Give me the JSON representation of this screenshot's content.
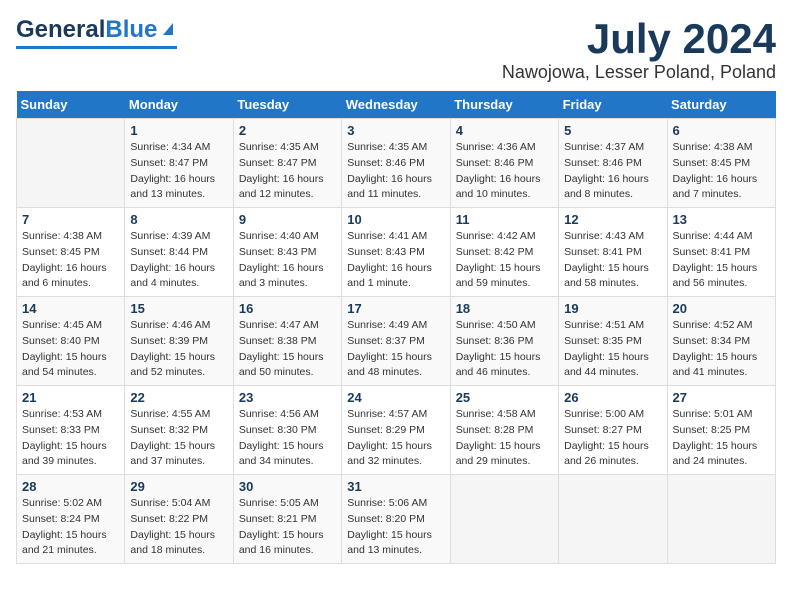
{
  "header": {
    "logo_general": "General",
    "logo_blue": "Blue",
    "main_title": "July 2024",
    "subtitle": "Nawojowa, Lesser Poland, Poland"
  },
  "calendar": {
    "days_of_week": [
      "Sunday",
      "Monday",
      "Tuesday",
      "Wednesday",
      "Thursday",
      "Friday",
      "Saturday"
    ],
    "weeks": [
      [
        {
          "day": "",
          "info": ""
        },
        {
          "day": "1",
          "info": "Sunrise: 4:34 AM\nSunset: 8:47 PM\nDaylight: 16 hours\nand 13 minutes."
        },
        {
          "day": "2",
          "info": "Sunrise: 4:35 AM\nSunset: 8:47 PM\nDaylight: 16 hours\nand 12 minutes."
        },
        {
          "day": "3",
          "info": "Sunrise: 4:35 AM\nSunset: 8:46 PM\nDaylight: 16 hours\nand 11 minutes."
        },
        {
          "day": "4",
          "info": "Sunrise: 4:36 AM\nSunset: 8:46 PM\nDaylight: 16 hours\nand 10 minutes."
        },
        {
          "day": "5",
          "info": "Sunrise: 4:37 AM\nSunset: 8:46 PM\nDaylight: 16 hours\nand 8 minutes."
        },
        {
          "day": "6",
          "info": "Sunrise: 4:38 AM\nSunset: 8:45 PM\nDaylight: 16 hours\nand 7 minutes."
        }
      ],
      [
        {
          "day": "7",
          "info": "Sunrise: 4:38 AM\nSunset: 8:45 PM\nDaylight: 16 hours\nand 6 minutes."
        },
        {
          "day": "8",
          "info": "Sunrise: 4:39 AM\nSunset: 8:44 PM\nDaylight: 16 hours\nand 4 minutes."
        },
        {
          "day": "9",
          "info": "Sunrise: 4:40 AM\nSunset: 8:43 PM\nDaylight: 16 hours\nand 3 minutes."
        },
        {
          "day": "10",
          "info": "Sunrise: 4:41 AM\nSunset: 8:43 PM\nDaylight: 16 hours\nand 1 minute."
        },
        {
          "day": "11",
          "info": "Sunrise: 4:42 AM\nSunset: 8:42 PM\nDaylight: 15 hours\nand 59 minutes."
        },
        {
          "day": "12",
          "info": "Sunrise: 4:43 AM\nSunset: 8:41 PM\nDaylight: 15 hours\nand 58 minutes."
        },
        {
          "day": "13",
          "info": "Sunrise: 4:44 AM\nSunset: 8:41 PM\nDaylight: 15 hours\nand 56 minutes."
        }
      ],
      [
        {
          "day": "14",
          "info": "Sunrise: 4:45 AM\nSunset: 8:40 PM\nDaylight: 15 hours\nand 54 minutes."
        },
        {
          "day": "15",
          "info": "Sunrise: 4:46 AM\nSunset: 8:39 PM\nDaylight: 15 hours\nand 52 minutes."
        },
        {
          "day": "16",
          "info": "Sunrise: 4:47 AM\nSunset: 8:38 PM\nDaylight: 15 hours\nand 50 minutes."
        },
        {
          "day": "17",
          "info": "Sunrise: 4:49 AM\nSunset: 8:37 PM\nDaylight: 15 hours\nand 48 minutes."
        },
        {
          "day": "18",
          "info": "Sunrise: 4:50 AM\nSunset: 8:36 PM\nDaylight: 15 hours\nand 46 minutes."
        },
        {
          "day": "19",
          "info": "Sunrise: 4:51 AM\nSunset: 8:35 PM\nDaylight: 15 hours\nand 44 minutes."
        },
        {
          "day": "20",
          "info": "Sunrise: 4:52 AM\nSunset: 8:34 PM\nDaylight: 15 hours\nand 41 minutes."
        }
      ],
      [
        {
          "day": "21",
          "info": "Sunrise: 4:53 AM\nSunset: 8:33 PM\nDaylight: 15 hours\nand 39 minutes."
        },
        {
          "day": "22",
          "info": "Sunrise: 4:55 AM\nSunset: 8:32 PM\nDaylight: 15 hours\nand 37 minutes."
        },
        {
          "day": "23",
          "info": "Sunrise: 4:56 AM\nSunset: 8:30 PM\nDaylight: 15 hours\nand 34 minutes."
        },
        {
          "day": "24",
          "info": "Sunrise: 4:57 AM\nSunset: 8:29 PM\nDaylight: 15 hours\nand 32 minutes."
        },
        {
          "day": "25",
          "info": "Sunrise: 4:58 AM\nSunset: 8:28 PM\nDaylight: 15 hours\nand 29 minutes."
        },
        {
          "day": "26",
          "info": "Sunrise: 5:00 AM\nSunset: 8:27 PM\nDaylight: 15 hours\nand 26 minutes."
        },
        {
          "day": "27",
          "info": "Sunrise: 5:01 AM\nSunset: 8:25 PM\nDaylight: 15 hours\nand 24 minutes."
        }
      ],
      [
        {
          "day": "28",
          "info": "Sunrise: 5:02 AM\nSunset: 8:24 PM\nDaylight: 15 hours\nand 21 minutes."
        },
        {
          "day": "29",
          "info": "Sunrise: 5:04 AM\nSunset: 8:22 PM\nDaylight: 15 hours\nand 18 minutes."
        },
        {
          "day": "30",
          "info": "Sunrise: 5:05 AM\nSunset: 8:21 PM\nDaylight: 15 hours\nand 16 minutes."
        },
        {
          "day": "31",
          "info": "Sunrise: 5:06 AM\nSunset: 8:20 PM\nDaylight: 15 hours\nand 13 minutes."
        },
        {
          "day": "",
          "info": ""
        },
        {
          "day": "",
          "info": ""
        },
        {
          "day": "",
          "info": ""
        }
      ]
    ]
  }
}
